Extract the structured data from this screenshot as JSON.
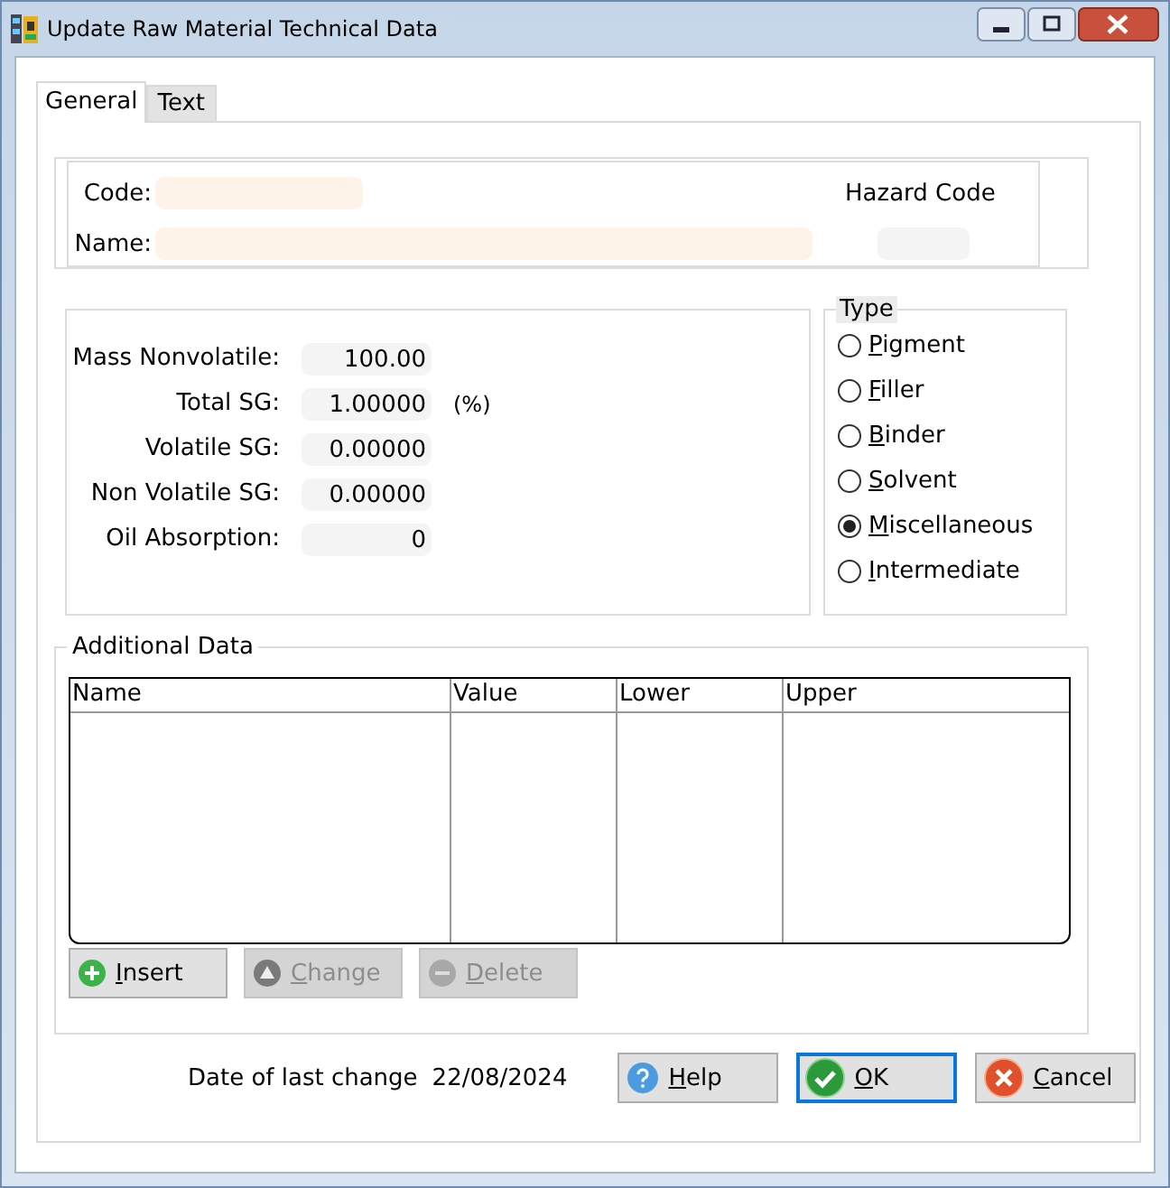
{
  "window": {
    "title": "Update Raw Material Technical Data"
  },
  "tabs": [
    {
      "label": "General",
      "selected": true
    },
    {
      "label": "Text",
      "selected": false
    }
  ],
  "identity": {
    "code_label": "Code:",
    "name_label": "Name:",
    "hazard_label": "Hazard Code"
  },
  "properties": [
    {
      "label": "Mass Nonvolatile:",
      "value": "100.00"
    },
    {
      "label": "Total SG:",
      "value": "1.00000",
      "unit": "(%)"
    },
    {
      "label": "Volatile SG:",
      "value": "0.00000"
    },
    {
      "label": "Non Volatile SG:",
      "value": "0.00000"
    },
    {
      "label": "Oil Absorption:",
      "value": "0"
    }
  ],
  "type_group": {
    "title": "Type",
    "options": [
      {
        "label": "Pigment",
        "selected": false
      },
      {
        "label": "Filler",
        "selected": false
      },
      {
        "label": "Binder",
        "selected": false
      },
      {
        "label": "Solvent",
        "selected": false
      },
      {
        "label": "Miscellaneous",
        "selected": true
      },
      {
        "label": "Intermediate",
        "selected": false
      }
    ]
  },
  "additional_data": {
    "title": "Additional Data",
    "columns": [
      "Name",
      "Value",
      "Lower",
      "Upper"
    ],
    "buttons": [
      {
        "label": "Insert",
        "kind": "add",
        "disabled": false
      },
      {
        "label": "Change",
        "kind": "up",
        "disabled": true
      },
      {
        "label": "Delete",
        "kind": "remove",
        "disabled": true
      }
    ]
  },
  "footer": {
    "date_label": "Date of last change",
    "date": "22/08/2024",
    "buttons": [
      {
        "label": "Help",
        "kind": "help",
        "default": false
      },
      {
        "label": "OK",
        "kind": "ok",
        "default": true
      },
      {
        "label": "Cancel",
        "kind": "cancel",
        "default": false
      }
    ]
  }
}
